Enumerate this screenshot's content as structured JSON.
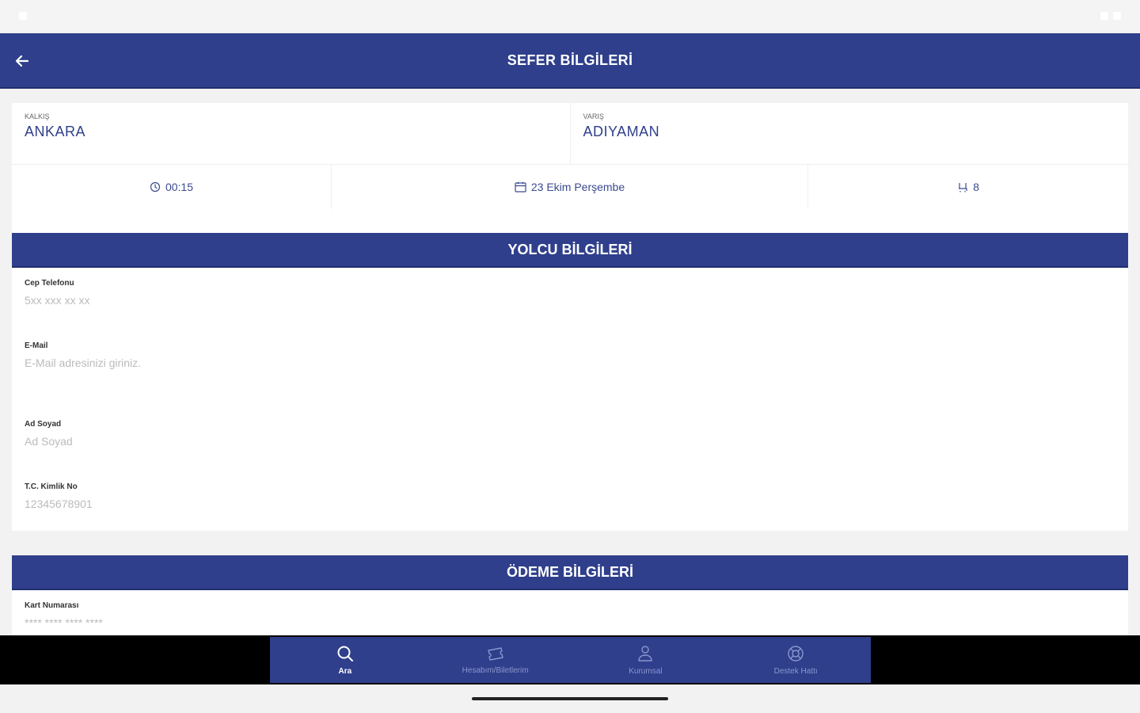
{
  "app_bar": {
    "title": "SEFER BİLGİLERİ"
  },
  "route": {
    "departure_label": "KALKIŞ",
    "departure_value": "ANKARA",
    "arrival_label": "VARIŞ",
    "arrival_value": "ADIYAMAN",
    "time": "00:15",
    "date": "23 Ekim Perşembe",
    "seat": "8"
  },
  "passenger": {
    "section_title": "YOLCU BİLGİLERİ",
    "phone_label": "Cep Telefonu",
    "phone_placeholder": "5xx xxx xx xx",
    "email_label": "E-Mail",
    "email_placeholder": "E-Mail adresinizi giriniz.",
    "name_label": "Ad Soyad",
    "name_placeholder": "Ad Soyad",
    "tc_label": "T.C. Kimlik No",
    "tc_placeholder": "12345678901"
  },
  "payment": {
    "section_title": "ÖDEME BİLGİLERİ",
    "card_label": "Kart Numarası",
    "card_placeholder": "**** **** **** ****"
  },
  "bottom_nav": {
    "items": [
      {
        "label": "Ara",
        "icon": "search-icon",
        "active": true
      },
      {
        "label": "Hesabım/Biletlerim",
        "icon": "ticket-icon",
        "active": false
      },
      {
        "label": "Kurumsal",
        "icon": "user-icon",
        "active": false
      },
      {
        "label": "Destek Hattı",
        "icon": "support-icon",
        "active": false
      }
    ]
  },
  "colors": {
    "primary": "#2f3f8c",
    "primary_dark": "#22306e",
    "background": "#f2f2f2"
  }
}
